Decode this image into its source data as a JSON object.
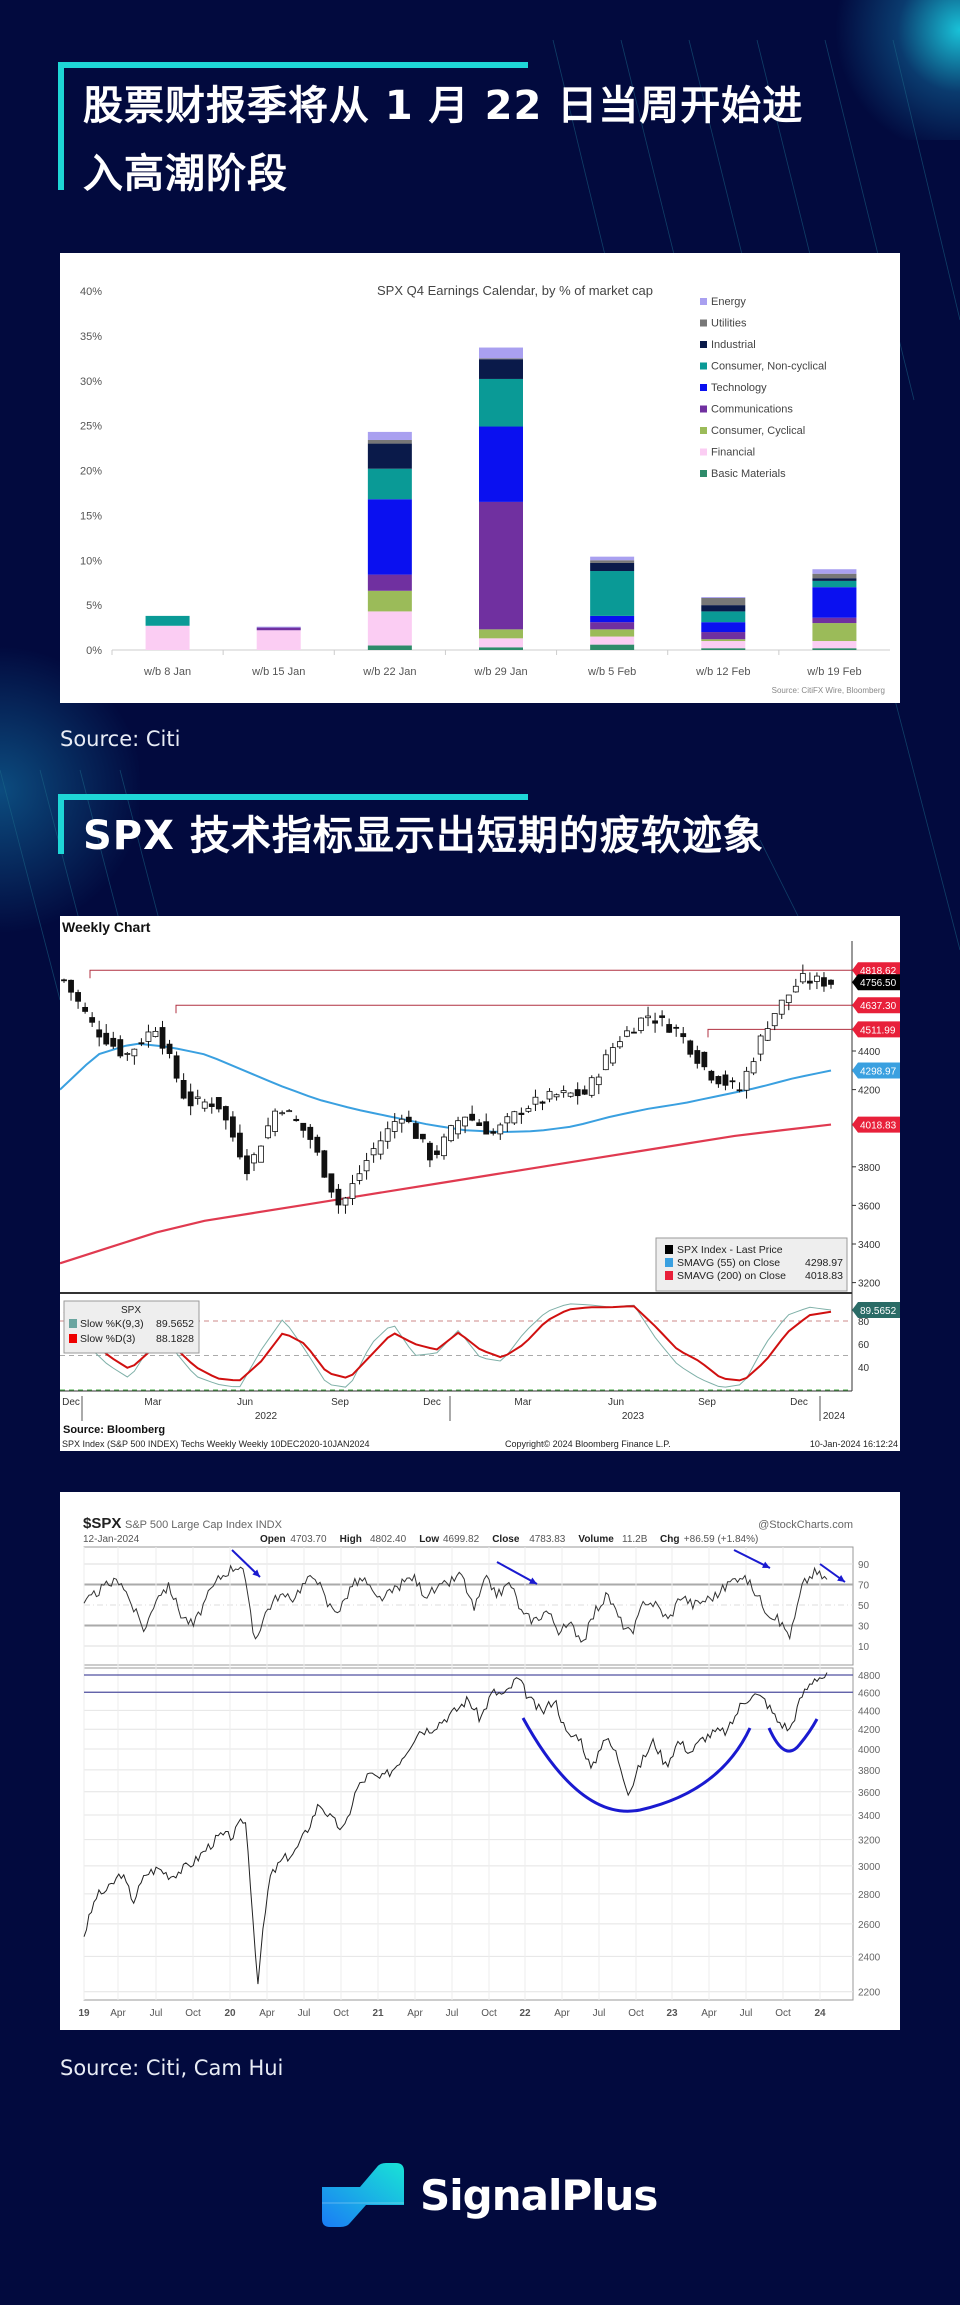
{
  "section1": {
    "title_line1": "股票财报季将从 1 月 22 日当周开始进",
    "title_line2": "入高潮阶段",
    "source": "Source: Citi"
  },
  "section2": {
    "title": "SPX 技术指标显示出短期的疲软迹象",
    "source": "Source: Citi, Cam Hui"
  },
  "brand": {
    "name": "SignalPlus",
    "logo_icon": "signalplus-logo-icon",
    "accent": "#1ed6d6",
    "background": "#020a3e"
  },
  "chart_data": [
    {
      "type": "bar",
      "stacked": true,
      "title": "SPX Q4 Earnings Calendar, by % of market cap",
      "source_note": "Source: CitiFX Wire, Bloomberg",
      "categories": [
        "w/b 8 Jan",
        "w/b 15 Jan",
        "w/b 22 Jan",
        "w/b 29 Jan",
        "w/b 5 Feb",
        "w/b 12 Feb",
        "w/b 19 Feb"
      ],
      "ylim": [
        0,
        40
      ],
      "yticks": [
        "0%",
        "5%",
        "10%",
        "15%",
        "20%",
        "25%",
        "30%",
        "35%",
        "40%"
      ],
      "legend_position": "top-right",
      "series": [
        {
          "name": "Basic Materials",
          "color": "#2e8b6a",
          "values": [
            0,
            0,
            0.5,
            0.3,
            0.6,
            0.2,
            0.2
          ]
        },
        {
          "name": "Financial",
          "color": "#fbcdf3",
          "values": [
            2.7,
            2.2,
            3.8,
            1.0,
            0.9,
            0.8,
            0.8
          ]
        },
        {
          "name": "Consumer, Cyclical",
          "color": "#9bbb59",
          "values": [
            0,
            0,
            2.3,
            1.0,
            0.8,
            0.2,
            2.0
          ]
        },
        {
          "name": "Communications",
          "color": "#7030a0",
          "values": [
            0,
            0.3,
            1.8,
            14.2,
            0.8,
            0.8,
            0.6
          ]
        },
        {
          "name": "Technology",
          "color": "#0a10f0",
          "values": [
            0,
            0,
            8.4,
            8.4,
            0.7,
            1.1,
            3.4
          ]
        },
        {
          "name": "Consumer, Non-cyclical",
          "color": "#0a9a96",
          "values": [
            1.1,
            0,
            3.4,
            5.3,
            5.0,
            1.2,
            0.7
          ]
        },
        {
          "name": "Industrial",
          "color": "#0a1a4a",
          "values": [
            0,
            0,
            2.8,
            2.2,
            0.9,
            0.7,
            0.3
          ]
        },
        {
          "name": "Utilities",
          "color": "#777777",
          "values": [
            0,
            0,
            0.4,
            0.1,
            0.3,
            0.8,
            0.5
          ]
        },
        {
          "name": "Energy",
          "color": "#a9a0f0",
          "values": [
            0,
            0.1,
            0.9,
            1.2,
            0.4,
            0.1,
            0.5
          ]
        }
      ]
    },
    {
      "type": "line",
      "title": "Weekly Chart",
      "x_labels": [
        "Dec",
        "Mar",
        "Jun",
        "Sep",
        "Dec",
        "Mar",
        "Jun",
        "Sep",
        "Dec"
      ],
      "year_labels": [
        "2022",
        "2023",
        "2024"
      ],
      "yticks": [
        "3200",
        "3400",
        "3600",
        "3800",
        "4200",
        "4400"
      ],
      "ylim": [
        3100,
        4900
      ],
      "price_labels": [
        {
          "value": "4818.62",
          "color": "#e8203a"
        },
        {
          "value": "4756.50",
          "color": "#000000"
        },
        {
          "value": "4637.30",
          "color": "#e8203a"
        },
        {
          "value": "4511.99",
          "color": "#e8203a"
        },
        {
          "value": "4298.97",
          "color": "#3aa0e0"
        },
        {
          "value": "4018.83",
          "color": "#e8203a"
        }
      ],
      "resistance_levels": [
        4818.62,
        4637.3,
        4511.99
      ],
      "monthly_close": {
        "months": [
          "Dec-21",
          "Jan-22",
          "Feb-22",
          "Mar-22",
          "Apr-22",
          "May-22",
          "Jun-22",
          "Jul-22",
          "Aug-22",
          "Sep-22",
          "Oct-22",
          "Nov-22",
          "Dec-22",
          "Jan-23",
          "Feb-23",
          "Mar-23",
          "Apr-23",
          "May-23",
          "Jun-23",
          "Jul-23",
          "Aug-23",
          "Sep-23",
          "Oct-23",
          "Nov-23",
          "Dec-23",
          "Jan-24"
        ],
        "values": [
          4766,
          4516,
          4374,
          4530,
          4132,
          4132,
          3785,
          4130,
          3955,
          3586,
          3872,
          4080,
          3840,
          4077,
          3970,
          4109,
          4169,
          4180,
          4450,
          4589,
          4508,
          4288,
          4194,
          4568,
          4770,
          4756
        ]
      },
      "sma55": [
        4200,
        4380,
        4440,
        4420,
        4380,
        4300,
        4220,
        4150,
        4100,
        4060,
        4020,
        3990,
        3980,
        3985,
        4010,
        4060,
        4100,
        4130,
        4170,
        4210,
        4260,
        4299
      ],
      "sma200": [
        3300,
        3380,
        3460,
        3520,
        3560,
        3600,
        3640,
        3680,
        3720,
        3760,
        3800,
        3840,
        3880,
        3920,
        3960,
        3990,
        4019
      ],
      "legend": {
        "items": [
          {
            "label": "SPX Index - Last Price",
            "value": "",
            "color": "#000000"
          },
          {
            "label": "SMAVG (55)  on Close",
            "value": "4298.97",
            "color": "#3aa0e0"
          },
          {
            "label": "SMAVG (200)  on Close",
            "value": "4018.83",
            "color": "#e8203a"
          }
        ]
      },
      "stochastic": {
        "title": "SPX",
        "k_label": "Slow %K(9,3)",
        "k_value": "89.5652",
        "d_label": "Slow %D(3)",
        "d_value": "88.1828",
        "current_label": "89.5652",
        "yticks": [
          "40",
          "60",
          "80"
        ],
        "d_series": [
          88,
          70,
          50,
          38,
          55,
          58,
          40,
          30,
          28,
          45,
          70,
          60,
          35,
          30,
          50,
          70,
          60,
          55,
          70,
          55,
          48,
          60,
          80,
          90,
          92,
          92,
          93,
          75,
          55,
          45,
          30,
          28,
          45,
          70,
          85,
          88
        ],
        "k_series": [
          85,
          60,
          42,
          30,
          60,
          55,
          32,
          25,
          22,
          55,
          82,
          55,
          25,
          22,
          60,
          78,
          50,
          52,
          72,
          48,
          45,
          70,
          88,
          95,
          94,
          92,
          94,
          65,
          42,
          30,
          22,
          25,
          60,
          85,
          92,
          89.6
        ]
      },
      "source": "Source: Bloomberg",
      "footer_left": "SPX Index (S&P 500 INDEX) Techs Weekly  Weekly 10DEC2020-10JAN2024",
      "footer_center": "Copyright© 2024 Bloomberg Finance L.P.",
      "footer_right": "10-Jan-2024 16:12:24"
    },
    {
      "type": "line",
      "symbol": "$SPX",
      "title": "S&P 500 Large Cap Index  INDX",
      "watermark": "@StockCharts.com",
      "date": "12-Jan-2024",
      "quote": [
        {
          "label": "Open",
          "value": "4703.70"
        },
        {
          "label": "High",
          "value": "4802.40"
        },
        {
          "label": "Low",
          "value": "4699.82"
        },
        {
          "label": "Close",
          "value": "4783.83"
        },
        {
          "label": "Volume",
          "value": "11.2B"
        },
        {
          "label": "Chg",
          "value": "+86.59 (+1.84%)"
        }
      ],
      "x_labels": [
        "19",
        "Apr",
        "Jul",
        "Oct",
        "20",
        "Apr",
        "Jul",
        "Oct",
        "21",
        "Apr",
        "Jul",
        "Oct",
        "22",
        "Apr",
        "Jul",
        "Oct",
        "23",
        "Apr",
        "Jul",
        "Oct",
        "24"
      ],
      "yticks": [
        "2200",
        "2400",
        "2600",
        "2800",
        "3000",
        "3200",
        "3400",
        "3600",
        "3800",
        "4000",
        "4200",
        "4400",
        "4600",
        "4800"
      ],
      "y_scale": "log",
      "rsi_yticks": [
        "10",
        "30",
        "50",
        "70",
        "90"
      ],
      "horizontal_levels": [
        4800,
        4600
      ],
      "monthly_close": {
        "values": [
          2530,
          2784,
          2834,
          2946,
          2752,
          2942,
          2980,
          2926,
          2977,
          3038,
          3141,
          3231,
          3226,
          3386,
          2237,
          2912,
          3044,
          3100,
          3271,
          3500,
          3363,
          3270,
          3622,
          3756,
          3714,
          3811,
          3973,
          4181,
          4204,
          4298,
          4395,
          4523,
          4308,
          4605,
          4567,
          4766,
          4516,
          4374,
          4530,
          4132,
          4132,
          3785,
          4130,
          3955,
          3586,
          3872,
          4080,
          3840,
          4077,
          3970,
          4109,
          4169,
          4180,
          4450,
          4589,
          4508,
          4288,
          4194,
          4568,
          4770,
          4784
        ]
      },
      "rsi": [
        50,
        62,
        70,
        75,
        48,
        25,
        60,
        68,
        40,
        30,
        55,
        75,
        85,
        90,
        15,
        45,
        60,
        55,
        70,
        80,
        50,
        45,
        70,
        75,
        55,
        60,
        70,
        78,
        60,
        65,
        72,
        80,
        45,
        75,
        60,
        72,
        40,
        35,
        45,
        25,
        30,
        15,
        45,
        60,
        35,
        20,
        55,
        50,
        35,
        60,
        50,
        55,
        60,
        72,
        80,
        65,
        45,
        35,
        20,
        70,
        82,
        75
      ],
      "annotations": [
        "arrows at RSI peaks",
        "cup and handle arcs"
      ]
    }
  ]
}
